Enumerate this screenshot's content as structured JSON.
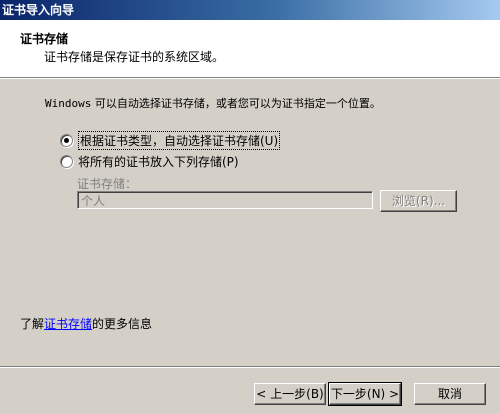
{
  "window": {
    "title": "证书导入向导"
  },
  "header": {
    "title": "证书存储",
    "description": "证书存储是保存证书的系统区域。"
  },
  "body": {
    "intro_prefix": "Windows",
    "intro_rest": " 可以自动选择证书存储，或者您可以为证书指定一个位置。",
    "options": [
      {
        "label": "根据证书类型，自动选择证书存储(U)",
        "checked": true
      },
      {
        "label": "将所有的证书放入下列存储(P)",
        "checked": false
      }
    ],
    "store_label": "证书存储：",
    "store_value": "个人",
    "browse_label": "浏览(R)..."
  },
  "info": {
    "prefix": "了解",
    "link": "证书存储",
    "suffix": "的更多信息"
  },
  "buttons": {
    "back": "< 上一步(B)",
    "next": "下一步(N) >",
    "cancel": "取消"
  }
}
